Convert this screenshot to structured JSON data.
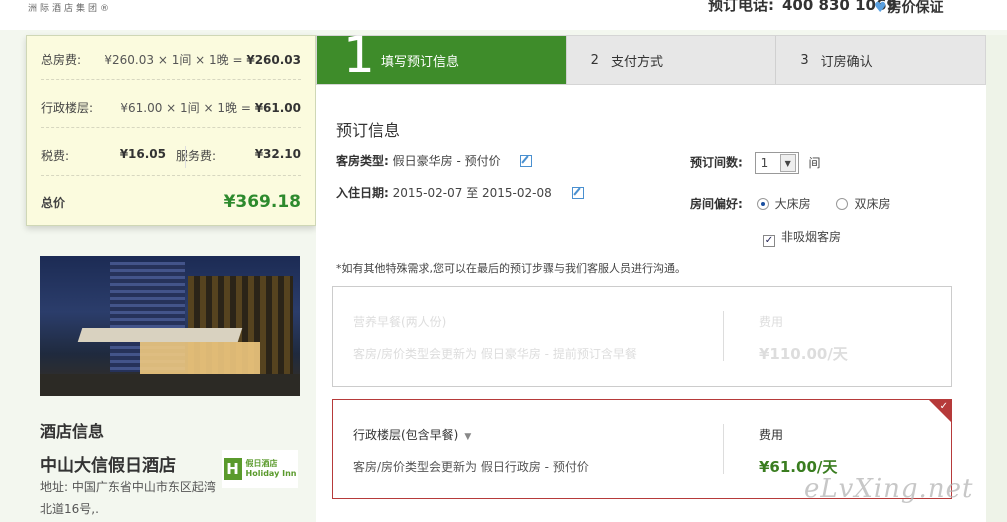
{
  "header": {
    "brand_text": "洲际酒店集团®",
    "hotline_label": "预订电话:",
    "hotline_number": "400 830 1069",
    "guarantee_label": "房价保证"
  },
  "summary": {
    "room_fee_label": "总房费:",
    "room_fee_formula": "¥260.03 × 1间 × 1晚 = ",
    "room_fee_total": "¥260.03",
    "exec_label": "行政楼层:",
    "exec_formula": "¥61.00 × 1间 × 1晚 = ",
    "exec_total": "¥61.00",
    "tax_label": "税费:",
    "tax_value": "¥16.05",
    "service_label": "服务费:",
    "service_value": "¥32.10",
    "total_label": "总价",
    "total_value": "¥369.18"
  },
  "hotel": {
    "section_title": "酒店信息",
    "name": "中山大信假日酒店",
    "address": "地址: 中国广东省中山市东区起湾北道16号,.",
    "logo_cn": "假日酒店",
    "logo_en": "Holiday Inn",
    "logo_mark": "H"
  },
  "steps": [
    {
      "num": "1",
      "label": "填写预订信息",
      "active": true
    },
    {
      "num": "2",
      "label": "支付方式",
      "active": false
    },
    {
      "num": "3",
      "label": "订房确认",
      "active": false
    }
  ],
  "booking": {
    "section_title": "预订信息",
    "room_type_label": "客房类型:",
    "room_type_value": "假日豪华房 - 预付价",
    "checkin_label": "入住日期:",
    "checkin_value": "2015-02-07 至 2015-02-08",
    "rooms_label": "预订间数:",
    "rooms_value": "1",
    "rooms_unit": "间",
    "pref_label": "房间偏好:",
    "pref_options": [
      "大床房",
      "双床房"
    ],
    "pref_selected": "大床房",
    "nonsmoking_label": "非吸烟客房",
    "nonsmoking_checked": true,
    "note": "*如有其他特殊需求,您可以在最后的预订步骤与我们客服人员进行沟通。"
  },
  "options": [
    {
      "title": "营养早餐(两人份)",
      "desc": "客房/房价类型会更新为 假日豪华房 - 提前预订含早餐",
      "fee_label": "费用",
      "price": "¥110.00/天",
      "selected": false
    },
    {
      "title": "行政楼层(包含早餐)",
      "desc": "客房/房价类型会更新为 假日行政房 - 预付价",
      "fee_label": "费用",
      "price": "¥61.00/天",
      "selected": true
    }
  ],
  "watermark": "eLvXing.net",
  "colors": {
    "accent_green": "#3e8c2a",
    "price_green": "#2d8a2d",
    "selected_border": "#b63a3a",
    "summary_bg": "#fbfbde"
  }
}
